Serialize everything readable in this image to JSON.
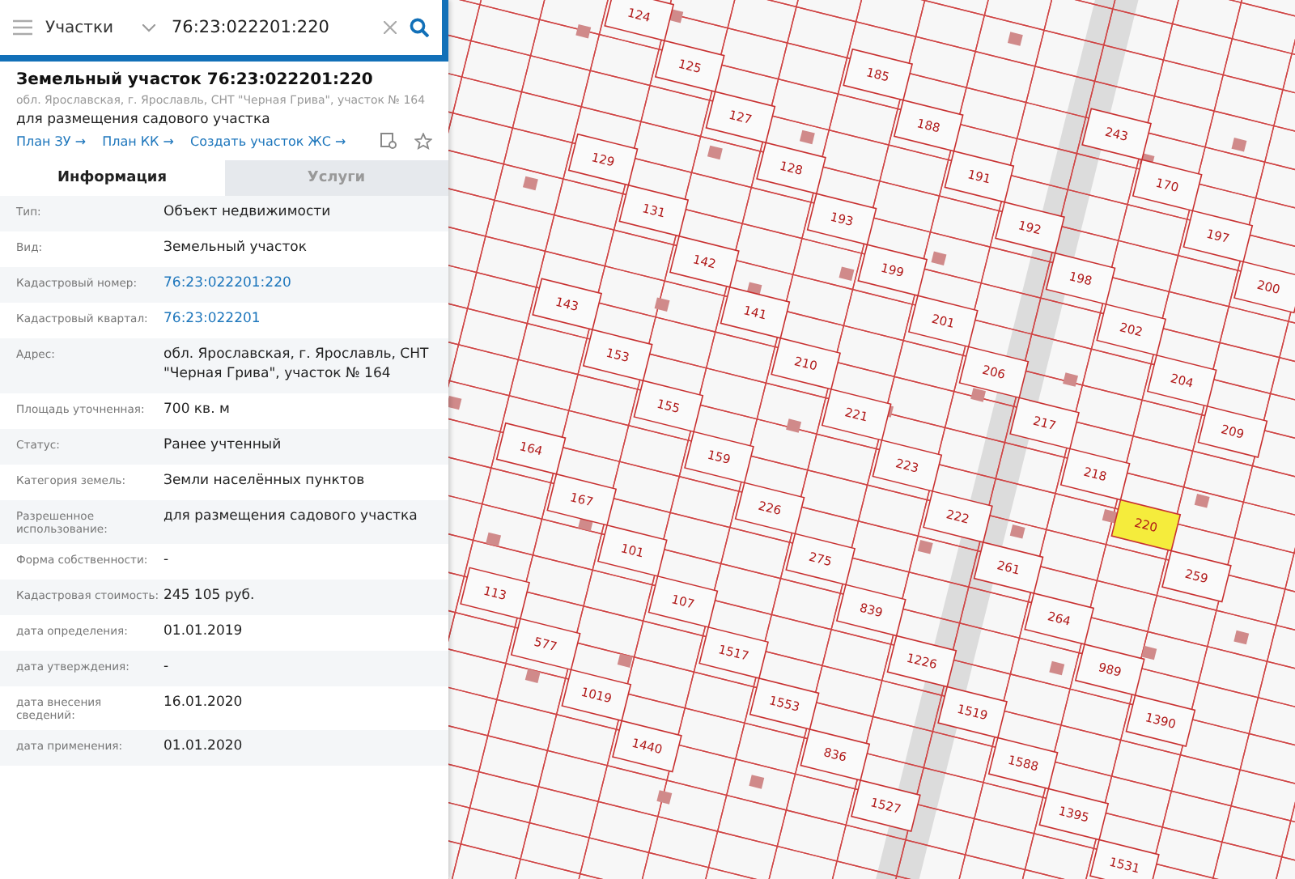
{
  "search": {
    "layer": "Участки",
    "query": "76:23:022201:220"
  },
  "object": {
    "title": "Земельный участок 76:23:022201:220",
    "address": "обл. Ярославская, г. Ярославль, СНТ \"Черная Грива\", участок № 164",
    "purpose": "для размещения садового участка",
    "links": [
      "План ЗУ →",
      "План КК →",
      "Создать участок ЖС →"
    ]
  },
  "tabs": [
    {
      "label": "Информация",
      "selected": true
    },
    {
      "label": "Услуги",
      "selected": false
    }
  ],
  "fields": [
    {
      "label": "Тип:",
      "value": "Объект недвижимости",
      "kind": "text"
    },
    {
      "label": "Вид:",
      "value": "Земельный участок",
      "kind": "text"
    },
    {
      "label": "Кадастровый номер:",
      "value": "76:23:022201:220",
      "kind": "link"
    },
    {
      "label": "Кадастровый квартал:",
      "value": "76:23:022201",
      "kind": "link"
    },
    {
      "label": "Адрес:",
      "value": "обл. Ярославская, г. Ярославль, СНТ \"Черная Грива\", участок № 164",
      "kind": "text"
    },
    {
      "label": "Площадь уточненная:",
      "value": "700 кв. м",
      "kind": "text"
    },
    {
      "label": "Статус:",
      "value": "Ранее учтенный",
      "kind": "text"
    },
    {
      "label": "Категория земель:",
      "value": "Земли населённых пунктов",
      "kind": "text"
    },
    {
      "label": "Разрешенное использование:",
      "value": "для размещения садового участка",
      "kind": "text"
    },
    {
      "label": "Форма собственности:",
      "value": "-",
      "kind": "text"
    },
    {
      "label": "Кадастровая стоимость:",
      "value": "245 105 руб.",
      "kind": "text"
    },
    {
      "label": "дата определения:",
      "value": "01.01.2019",
      "kind": "text"
    },
    {
      "label": "дата утверждения:",
      "value": "-",
      "kind": "text"
    },
    {
      "label": "дата внесения сведений:",
      "value": "16.01.2020",
      "kind": "text"
    },
    {
      "label": "дата применения:",
      "value": "01.01.2020",
      "kind": "text"
    }
  ],
  "map": {
    "parcels": [
      {
        "label": "124",
        "selected": false
      },
      {
        "label": "185",
        "selected": false
      },
      {
        "label": "243",
        "selected": false
      },
      {
        "label": "125",
        "selected": false
      },
      {
        "label": "188",
        "selected": false
      },
      {
        "label": "170",
        "selected": false
      },
      {
        "label": "127",
        "selected": false
      },
      {
        "label": "191",
        "selected": false
      },
      {
        "label": "197",
        "selected": false
      },
      {
        "label": "128",
        "selected": false
      },
      {
        "label": "192",
        "selected": false
      },
      {
        "label": "200",
        "selected": false
      },
      {
        "label": "129",
        "selected": false
      },
      {
        "label": "193",
        "selected": false
      },
      {
        "label": "198",
        "selected": false
      },
      {
        "label": "131",
        "selected": false
      },
      {
        "label": "199",
        "selected": false
      },
      {
        "label": "202",
        "selected": false
      },
      {
        "label": "142",
        "selected": false
      },
      {
        "label": "201",
        "selected": false
      },
      {
        "label": "204",
        "selected": false
      },
      {
        "label": "141",
        "selected": false
      },
      {
        "label": "206",
        "selected": false
      },
      {
        "label": "209",
        "selected": false
      },
      {
        "label": "143",
        "selected": false
      },
      {
        "label": "210",
        "selected": false
      },
      {
        "label": "217",
        "selected": false
      },
      {
        "label": "153",
        "selected": false
      },
      {
        "label": "221",
        "selected": false
      },
      {
        "label": "218",
        "selected": false
      },
      {
        "label": "155",
        "selected": false
      },
      {
        "label": "223",
        "selected": false
      },
      {
        "label": "220",
        "selected": true
      },
      {
        "label": "159",
        "selected": false
      },
      {
        "label": "222",
        "selected": false
      },
      {
        "label": "259",
        "selected": false
      },
      {
        "label": "164",
        "selected": false
      },
      {
        "label": "226",
        "selected": false
      },
      {
        "label": "261",
        "selected": false
      },
      {
        "label": "167",
        "selected": false
      },
      {
        "label": "275",
        "selected": false
      },
      {
        "label": "264",
        "selected": false
      },
      {
        "label": "101",
        "selected": false
      },
      {
        "label": "839",
        "selected": false
      },
      {
        "label": "989",
        "selected": false
      },
      {
        "label": "107",
        "selected": false
      },
      {
        "label": "1226",
        "selected": false
      },
      {
        "label": "1390",
        "selected": false
      },
      {
        "label": "113",
        "selected": false
      },
      {
        "label": "1517",
        "selected": false
      },
      {
        "label": "1519",
        "selected": false
      },
      {
        "label": "577",
        "selected": false
      },
      {
        "label": "1553",
        "selected": false
      },
      {
        "label": "1588",
        "selected": false
      },
      {
        "label": "1019",
        "selected": false
      },
      {
        "label": "836",
        "selected": false
      },
      {
        "label": "1395",
        "selected": false
      },
      {
        "label": "1440",
        "selected": false
      },
      {
        "label": "1527",
        "selected": false
      },
      {
        "label": "1531",
        "selected": false
      }
    ]
  }
}
